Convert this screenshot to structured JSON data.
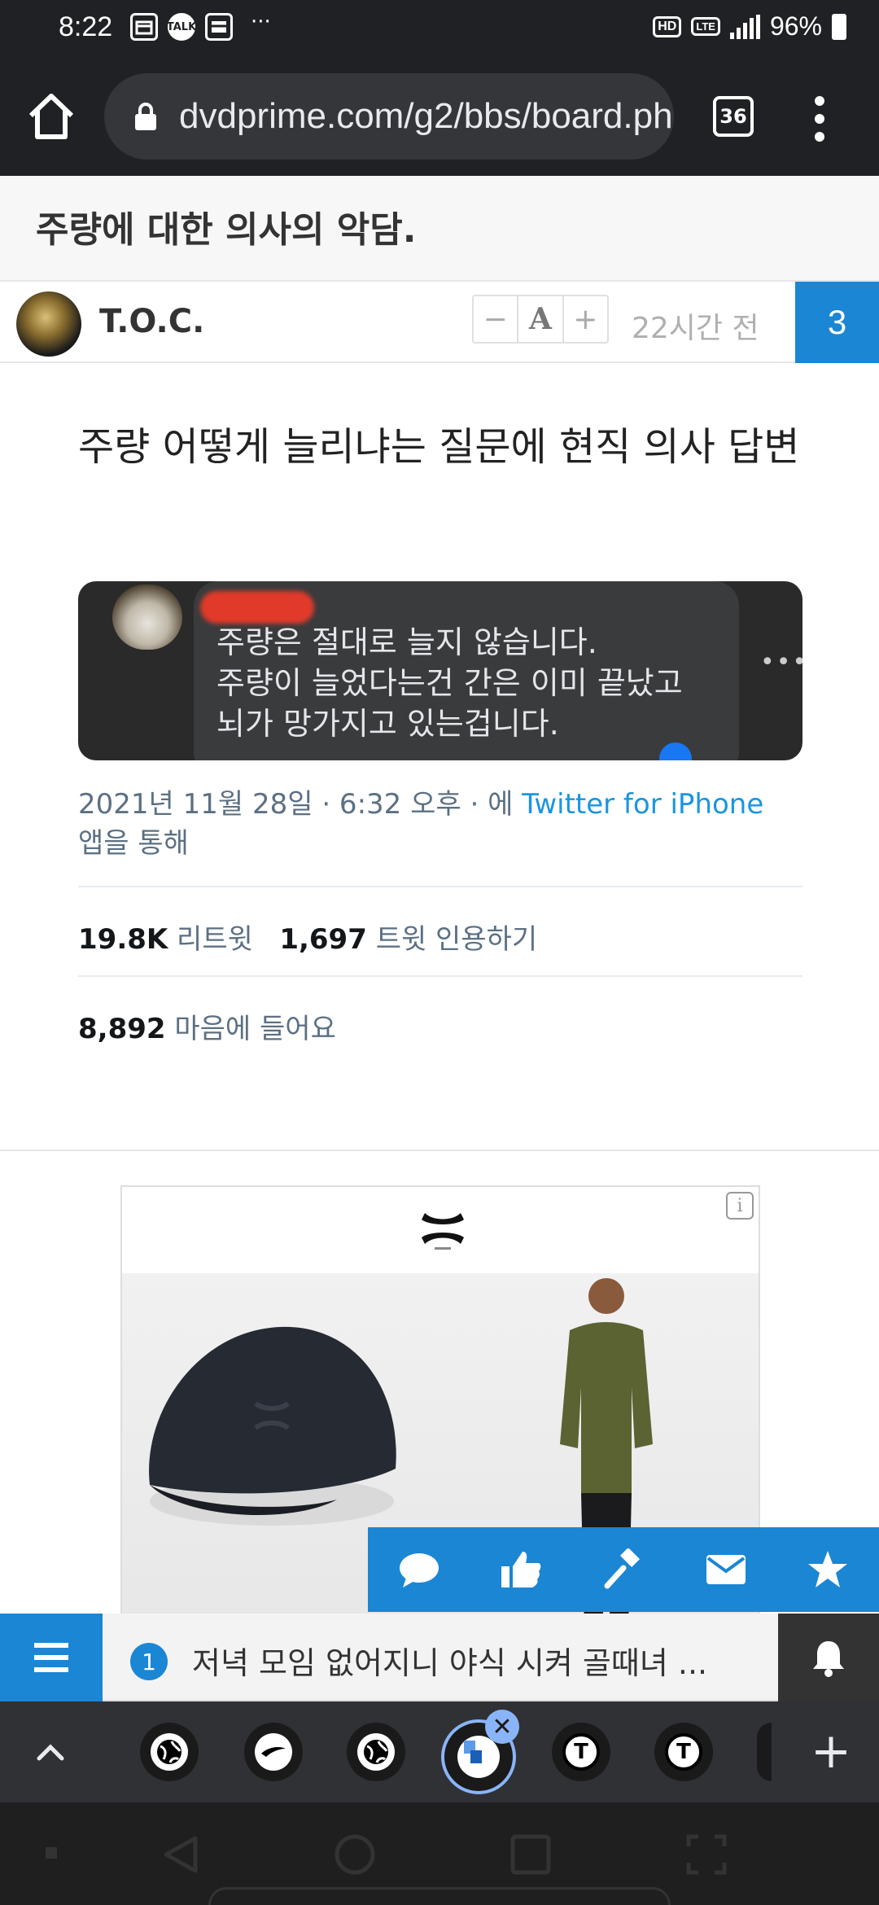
{
  "status_bar": {
    "time": "8:22",
    "notif_icons": [
      "calendar-icon",
      "kakaotalk-icon",
      "message-icon"
    ],
    "notif_talk_label": "TALK",
    "more_dots": "···",
    "network_badge": "HD",
    "lte_badge": "LTE",
    "battery": "96%"
  },
  "browser": {
    "url": "dvdprime.com/g2/bbs/board.php",
    "tab_count": "36"
  },
  "post": {
    "title": "주량에 대한 의사의 악담.",
    "author": "T.O.C.",
    "font_minus": "−",
    "font_a": "A",
    "font_plus": "+",
    "time_ago": "22시간 전",
    "comment_count": "3"
  },
  "article": {
    "headline": "주량 어떻게 늘리냐는 질문에 현직 의사 답변",
    "tweet_text_lines": [
      "주량은 절대로 늘지 않습니다.",
      "주량이 늘었다는건 간은 이미 끝났고",
      "뇌가 망가지고 있는겁니다."
    ],
    "tweet_date": "2021년 11월 28일 · 6:32 오후 · 에 ",
    "tweet_via": "Twitter for iPhone",
    "tweet_via_suffix": "앱을 통해",
    "retweets_value": "19.8K",
    "retweets_label": "리트윗",
    "quotes_value": "1,697",
    "quotes_label": "트윗 인용하기",
    "likes_value": "8,892",
    "likes_label": "마음에 들어요"
  },
  "ad": {
    "info_label": "i",
    "brand_icon": "under-armour-logo"
  },
  "action_bar": {
    "items": [
      "comment-icon",
      "thumbs-up-icon",
      "gavel-icon",
      "mail-icon",
      "star-icon"
    ]
  },
  "notification": {
    "number": "1",
    "text": "저녁 모임 없어지니 야식 시켜 골때녀 ..."
  },
  "tabstrip": {
    "tabs": [
      "globe-icon",
      "reebok-icon",
      "globe-icon",
      "dvdprime-icon",
      "t-icon",
      "t-icon"
    ],
    "t_label": "T",
    "close_label": "✕",
    "plus_label": "+"
  },
  "colors": {
    "accent": "#1b86d4",
    "chrome_dark": "#202124",
    "link": "#1b95e0"
  }
}
